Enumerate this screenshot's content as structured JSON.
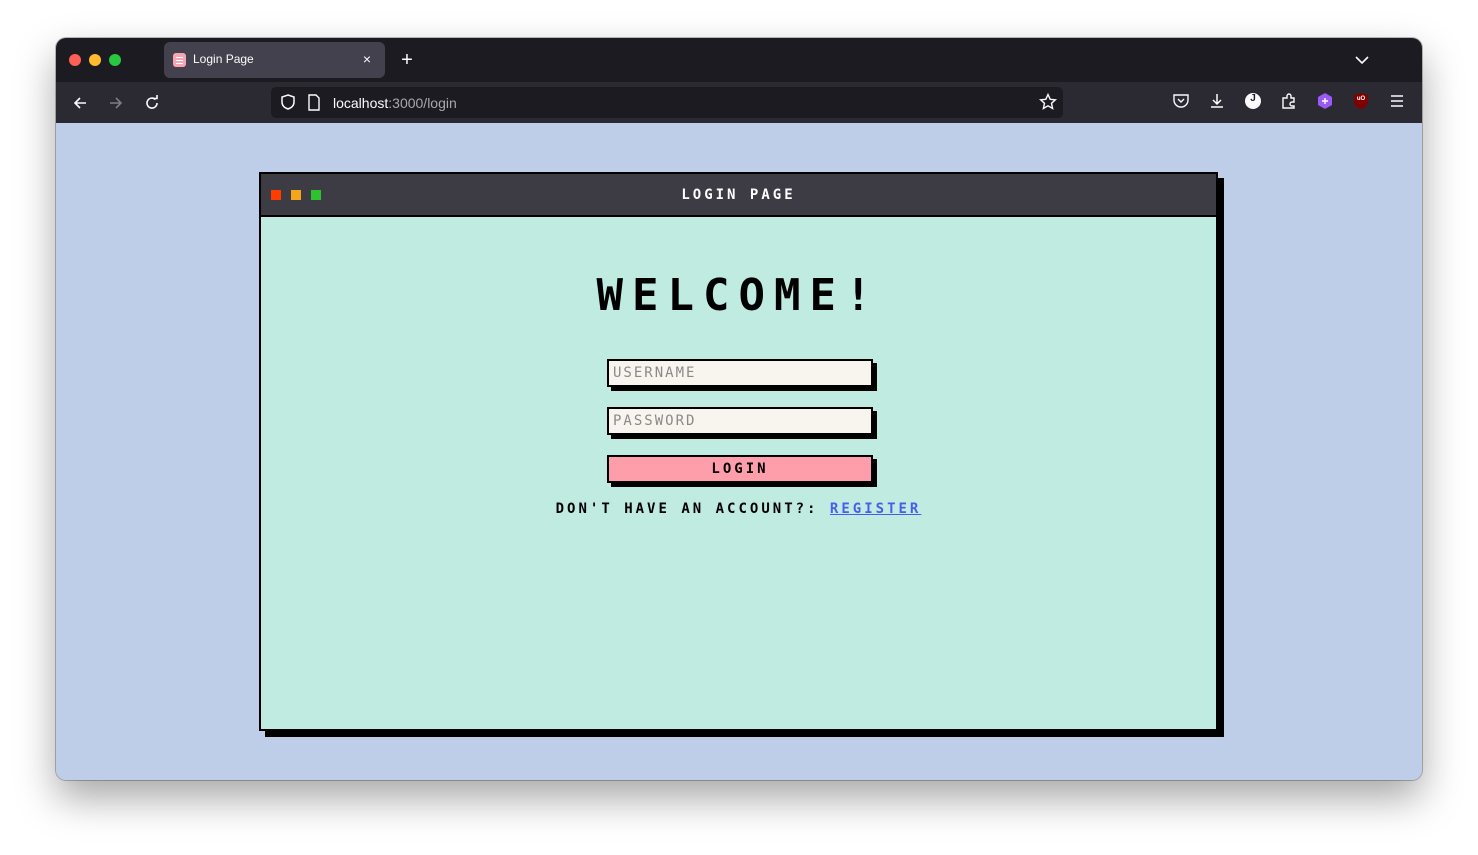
{
  "browser": {
    "tab_title": "Login Page",
    "tab_close": "×",
    "new_tab": "+",
    "url_host": "localhost",
    "url_rest": ":3000/login",
    "accent_profile": "#ffffff",
    "icons": {
      "back": "arrow-left-icon",
      "forward": "arrow-right-icon",
      "reload": "reload-icon",
      "shield": "shield-icon",
      "page": "page-icon",
      "bookmark": "star-icon",
      "pocket": "pocket-icon",
      "downloads": "download-icon",
      "account": "account-icon",
      "extensions": "puzzle-icon",
      "extension_purple": "extension-icon",
      "ublock": "ublock-icon",
      "menu": "hamburger-menu-icon"
    },
    "account_initial": "J",
    "ublock_label": "uO"
  },
  "app": {
    "window_title": "Login Page",
    "heading": "Welcome!",
    "username_placeholder": "USERNAME",
    "password_placeholder": "PASSWORD",
    "login_label": "Login",
    "register_prompt": "Don't have an account?: ",
    "register_link": "Register",
    "colors": {
      "page_bg": "#bfcee8",
      "window_bg": "#c0ebe1",
      "titlebar_bg": "#3d3b44",
      "button_bg": "#ff9eab",
      "link": "#4a5cf0",
      "dot_red": "#ff3d00",
      "dot_yellow": "#f2a71b",
      "dot_green": "#2fc22f"
    }
  }
}
